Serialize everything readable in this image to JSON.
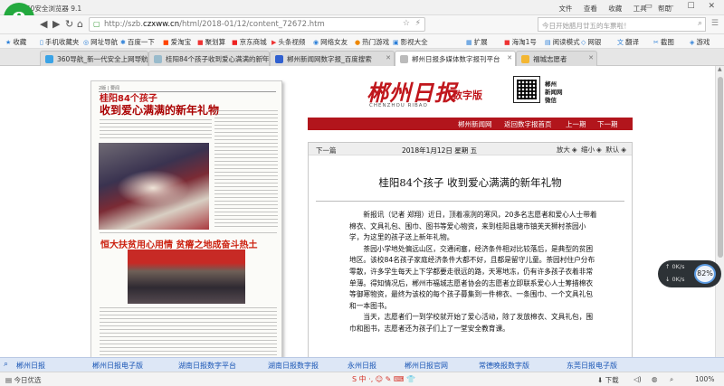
{
  "window": {
    "title": "360安全浏览器 9.1",
    "menu": [
      "文件",
      "查看",
      "收藏",
      "工具",
      "帮助"
    ],
    "controls": "▭ — ☐ ✕"
  },
  "nav": {
    "url_prefix": "http://szb.",
    "url_domain": "czxww.cn",
    "url_path": "/html/2018-01/12/content_72672.htm",
    "search_placeholder": "今日开始腊月廿五的车票啦！"
  },
  "bookmarks": [
    "收藏",
    "手机收藏夹",
    "网址导航",
    "百度一下",
    "爱淘宝",
    "聚划算",
    "京东商城",
    "头条视频",
    "网络女友",
    "热门游戏",
    "影视大全",
    "扩展",
    "海淘1号",
    "阅读模式",
    "网银",
    "翻译",
    "截图",
    "游戏"
  ],
  "tabs": [
    {
      "label": "360导航_新一代安全上网导航",
      "active": false
    },
    {
      "label": "桂阳84个孩子收到爱心满满的新年礼",
      "active": false
    },
    {
      "label": "郴州新闻网数字报_百度搜索",
      "active": false
    },
    {
      "label": "郴州日报多媒体数字报刊平台",
      "active": true
    },
    {
      "label": "福城志愿者",
      "active": false
    }
  ],
  "newspaper": {
    "header": "2版 | 要闻",
    "title_line1": "桂阳84个孩子",
    "title_line2": "收到爱心满满的新年礼物",
    "side_heading": "",
    "title2": "恒大扶贫用心用情 贫瘠之地成奋斗热土",
    "banner": ""
  },
  "masthead": {
    "logo": "郴州日报",
    "sub": "数字版",
    "english": "CHENZHOU RIBAO",
    "qr_label_1": "郴州",
    "qr_label_2": "新闻网",
    "qr_label_3": "微信"
  },
  "rednav": [
    "郴州新闻网",
    "返回数字报首页",
    "上一期",
    "下一期"
  ],
  "article": {
    "prev_label": "下一篇",
    "date": "2018年1月12日  星期 五",
    "zoom_in": "放大",
    "zoom_out": "缩小",
    "reset": "默认",
    "headline": "桂阳84个孩子  收到爱心满满的新年礼物",
    "paragraphs": [
      "新报讯（记者 郑翔）近日，顶着凛冽的寒风，20多名志愿者和爱心人士带着棉衣、文具礼包、围巾、图书等爱心物资，来到桂阳县塘市镇芙天狮村茶园小学，为这里的孩子送上新年礼物。",
      "茶园小学地处偏远山区，交通闭塞，经济条件相对比较落后，是典型的贫困地区。该校84名孩子家庭经济条件大都不好，且都是留守儿童。茶园村住户分布零散，许多学生每天上下学都要走很远的路，天寒地冻，仍有许多孩子衣着非常单薄。得知情况后，郴州市福城志愿者协会的志愿者立即联系爱心人士筹措棉衣等御寒物资，最终为该校的每个孩子募集到一件棉衣、一条围巾、一个文具礼包和一本图书。",
      "当天，志愿者们一到学校就开始了爱心活动，除了发放棉衣、文具礼包，围巾和图书，志愿者还为孩子们上了一堂安全教育课。"
    ]
  },
  "widget": {
    "k1": "0K/s",
    "k2": "0K/s",
    "pct": "82%"
  },
  "sitebar": [
    "郴州日报",
    "郴州日报电子版",
    "湖南日报数字平台",
    "湖南日报数字报",
    "永州日报",
    "郴州日报官网",
    "常德晚报数字版",
    "东莞日报电子版"
  ],
  "status": {
    "left": "今日优选",
    "ime": "S 中 ·, ☺ ✎ ⌨ 👕",
    "items": [
      "下载",
      "",
      "100%"
    ]
  }
}
